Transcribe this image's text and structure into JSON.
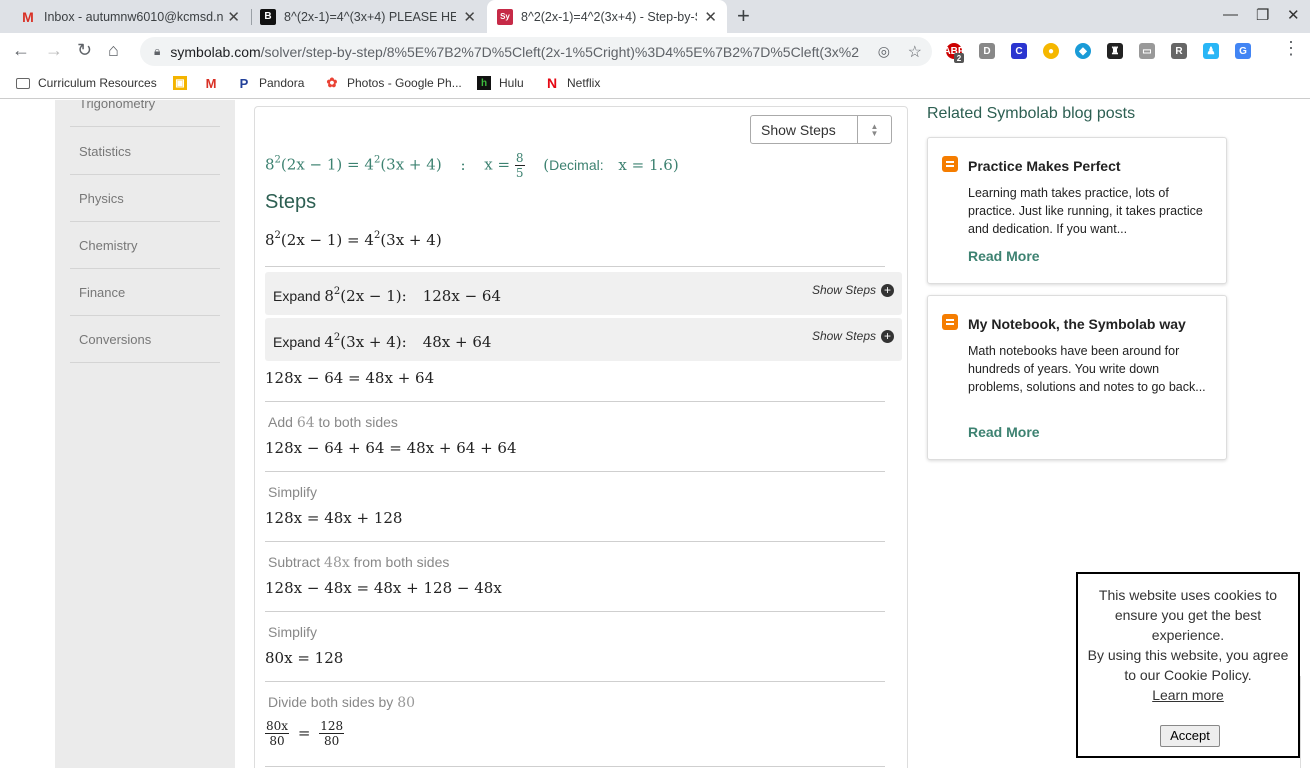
{
  "browser": {
    "tabs": [
      {
        "title": "Inbox - autumnw6010@kcmsd.n",
        "icon": "gmail-icon"
      },
      {
        "title": "8^(2x-1)=4^(3x+4) PLEASE HELP",
        "icon": "brainly-icon"
      },
      {
        "title": "8^2(2x-1)=4^2(3x+4) - Step-by-St",
        "icon": "symbolab-icon"
      }
    ],
    "url_host": "symbolab.com",
    "url_path": "/solver/step-by-step/8%5E%7B2%7D%5Cleft(2x-1%5Cright)%3D4%5E%7B2%7D%5Cleft(3x%2B...",
    "ext_badge": "2",
    "bookmarks": [
      "Curriculum Resources",
      "",
      "Pandora",
      "Photos - Google Ph...",
      "Hulu",
      "Netflix"
    ]
  },
  "sidebar": {
    "items": [
      "Trigonometry",
      "Statistics",
      "Physics",
      "Chemistry",
      "Finance",
      "Conversions"
    ]
  },
  "solution": {
    "dropdown_label": "Show Steps",
    "problem_lhs": "8",
    "problem_lhs_exp": "2",
    "problem_lhs_rest": "(2x − 1) = 4",
    "problem_rhs_exp": "2",
    "problem_rhs_rest": "(3x + 4)",
    "colon": ":",
    "answer_var": "x =",
    "answer_num": "8",
    "answer_den": "5",
    "decimal_label": "Decimal:",
    "decimal_value": "x = 1.6",
    "steps_title": "Steps",
    "equation_line": "(2x − 1) = 4",
    "expand1_label": "Expand",
    "expand1_expr": "(2x − 1):",
    "expand1_result": "128x − 64",
    "expand2_label": "Expand",
    "expand2_expr": "(3x + 4):",
    "expand2_result": "48x + 64",
    "show_steps": "Show Steps",
    "eq1": "128x − 64 = 48x + 64",
    "desc_add": "Add",
    "desc_add_val": "64",
    "desc_add_tail": "to both sides",
    "eq2": "128x − 64 + 64 = 48x + 64 + 64",
    "desc_simplify": "Simplify",
    "eq3": "128x = 48x + 128",
    "desc_subtract": "Subtract",
    "desc_subtract_val": "48x",
    "desc_subtract_tail": "from both sides",
    "eq4": "128x − 48x = 48x + 128 − 48x",
    "eq5": "80x = 128",
    "desc_divide": "Divide both sides by",
    "desc_divide_val": "80",
    "frac1_num": "80x",
    "frac1_den": "80",
    "frac2_num": "128",
    "frac2_den": "80"
  },
  "related": {
    "title": "Related Symbolab blog posts",
    "posts": [
      {
        "title": "Practice Makes Perfect",
        "body": "Learning math takes practice, lots of practice. Just like running, it takes practice and dedication. If you want...",
        "link": "Read More"
      },
      {
        "title": "My Notebook, the Symbolab way",
        "body": "Math notebooks have been around for hundreds of years. You write down problems, solutions and notes to go back...",
        "link": "Read More"
      }
    ]
  },
  "cookie": {
    "text1": "This website uses cookies to ensure you get the best experience.",
    "text2": "By using this website, you agree to our Cookie Policy.",
    "learn_more": "Learn more",
    "accept": "Accept"
  },
  "colors": {
    "accent": "#3d8271",
    "blog": "#f57d00"
  }
}
